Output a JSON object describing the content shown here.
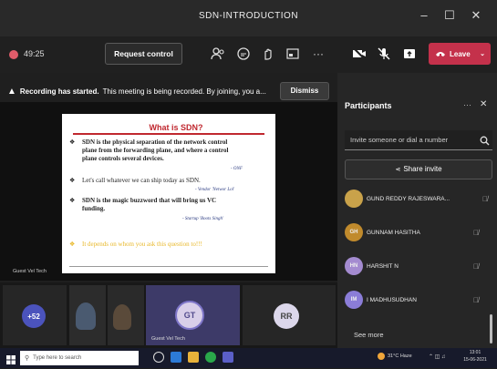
{
  "window": {
    "title": "SDN-INTRODUCTION",
    "controls": {
      "minimize": "–",
      "maximize": "☐",
      "close": "✕"
    }
  },
  "toolbar": {
    "timer": "49:25",
    "request_control": "Request control",
    "leave": "Leave",
    "icons": [
      "people-icon",
      "chat-icon",
      "raise-hand-icon",
      "room-icon",
      "more-icon",
      "camera-off-icon",
      "mic-off-icon",
      "share-icon"
    ]
  },
  "banner": {
    "bold": "Recording has started.",
    "text": "This meeting is being recorded. By joining, you a...",
    "dismiss": "Dismiss"
  },
  "slide": {
    "title": "What is SDN?",
    "bullet1": "SDN is the physical separation of the network control",
    "bullet1b": "plane from the forwarding plane, and where a control",
    "bullet1c": "plane controls several devices.",
    "author1": "- ONF",
    "bullet2": "Let's call whatever we can ship today as SDN.",
    "author2": "- Vendor 'Networ Lol'",
    "bullet3": "SDN is the magic buzzword that will bring us VC",
    "bullet3b": "funding.",
    "author3": "- Startup 'Boots Singh'",
    "bullet4": "It depends on whom you ask this question to!!!"
  },
  "stage": {
    "guest_label": "Guest Vel Tech"
  },
  "tiles": {
    "overflow": "+52",
    "gt": "GT",
    "gt_label": "Guest Vel Tech",
    "rr": "RR"
  },
  "panel": {
    "title": "Participants",
    "invite_placeholder": "Invite someone or dial a number",
    "share_invite": "Share invite",
    "participants": [
      {
        "name": "GUND REDDY RAJESWARA...",
        "initials": "",
        "color": "#c9a24a"
      },
      {
        "name": "GUNNAM HASITHA",
        "initials": "GH",
        "color": "#c08a2c"
      },
      {
        "name": "HARSHIT N",
        "initials": "HN",
        "color": "#a48bd0"
      },
      {
        "name": "I MADHUSUDHAN",
        "initials": "IM",
        "color": "#8b7dd8"
      }
    ],
    "see_more": "See more"
  },
  "taskbar": {
    "search": "Type here to search",
    "weather": "31°C Haze",
    "time": "13:01",
    "date": "15-06-2021"
  }
}
